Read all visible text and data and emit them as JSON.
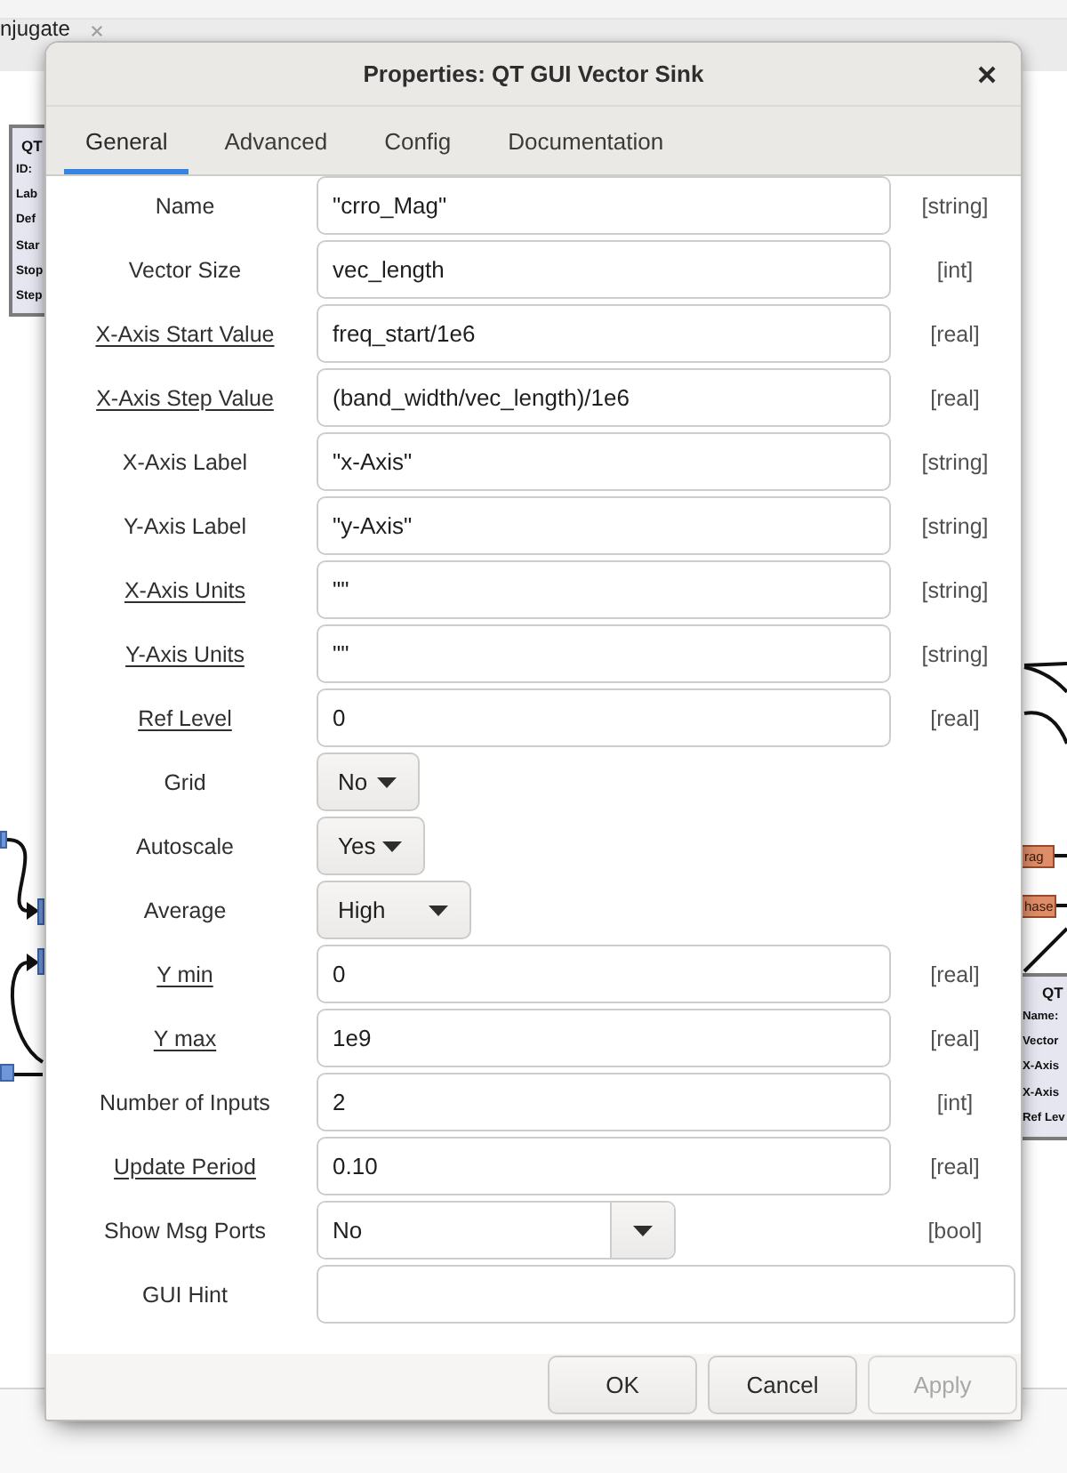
{
  "background": {
    "editor_tab": {
      "label": "njugate"
    },
    "blocks": [
      {
        "title": "QT",
        "fields": [
          "ID:",
          "Lab",
          "Def",
          "Star",
          "Stop",
          "Step"
        ]
      },
      {
        "title": "QT",
        "fields": [
          "Name:",
          "Vector",
          "X-Axis",
          "X-Axis",
          "Ref Lev"
        ]
      }
    ],
    "port_labels": [
      "rag",
      "hase"
    ]
  },
  "dialog": {
    "title": "Properties: QT GUI Vector Sink",
    "tabs": [
      {
        "label": "General",
        "selected": true
      },
      {
        "label": "Advanced",
        "selected": false
      },
      {
        "label": "Config",
        "selected": false
      },
      {
        "label": "Documentation",
        "selected": false
      }
    ],
    "params": [
      {
        "label": "Name",
        "underlined": false,
        "kind": "entry",
        "value": "\"crro_Mag\"",
        "type": "[string]"
      },
      {
        "label": "Vector Size",
        "underlined": false,
        "kind": "entry",
        "value": "vec_length",
        "type": "[int]"
      },
      {
        "label": "X-Axis Start Value",
        "underlined": true,
        "kind": "entry",
        "value": "freq_start/1e6",
        "type": "[real]"
      },
      {
        "label": "X-Axis Step Value",
        "underlined": true,
        "kind": "entry",
        "value": "(band_width/vec_length)/1e6",
        "type": "[real]"
      },
      {
        "label": "X-Axis Label",
        "underlined": false,
        "kind": "entry",
        "value": "\"x-Axis\"",
        "type": "[string]"
      },
      {
        "label": "Y-Axis Label",
        "underlined": false,
        "kind": "entry",
        "value": "\"y-Axis\"",
        "type": "[string]"
      },
      {
        "label": "X-Axis Units",
        "underlined": true,
        "kind": "entry",
        "value": "\"\"",
        "type": "[string]"
      },
      {
        "label": "Y-Axis Units",
        "underlined": true,
        "kind": "entry",
        "value": "\"\"",
        "type": "[string]"
      },
      {
        "label": "Ref Level",
        "underlined": true,
        "kind": "entry",
        "value": "0",
        "type": "[real]"
      },
      {
        "label": "Grid",
        "underlined": false,
        "kind": "dropdown",
        "value": "No"
      },
      {
        "label": "Autoscale",
        "underlined": false,
        "kind": "dropdown",
        "value": "Yes"
      },
      {
        "label": "Average",
        "underlined": false,
        "kind": "dropdown",
        "value": "High"
      },
      {
        "label": "Y min",
        "underlined": true,
        "kind": "entry",
        "value": "0",
        "type": "[real]"
      },
      {
        "label": "Y max",
        "underlined": true,
        "kind": "entry",
        "value": "1e9",
        "type": "[real]"
      },
      {
        "label": "Number of Inputs",
        "underlined": false,
        "kind": "entry",
        "value": "2",
        "type": "[int]"
      },
      {
        "label": "Update Period",
        "underlined": true,
        "kind": "entry",
        "value": "0.10",
        "type": "[real]"
      },
      {
        "label": "Show Msg Ports",
        "underlined": false,
        "kind": "combo",
        "value": "No",
        "type": "[bool]"
      },
      {
        "label": "GUI Hint",
        "underlined": false,
        "kind": "entry"
      }
    ],
    "buttons": [
      {
        "label": "OK",
        "disabled": false
      },
      {
        "label": "Cancel",
        "disabled": false
      },
      {
        "label": "Apply",
        "disabled": true
      }
    ]
  }
}
